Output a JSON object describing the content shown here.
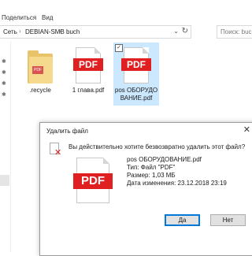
{
  "ribbon": {
    "tabs": [
      "Поделиться",
      "Вид"
    ]
  },
  "address": {
    "path": [
      "Сеть",
      "DEBIAN-SMB",
      "buch"
    ],
    "separator": "›",
    "search_placeholder": "Поиск: buch"
  },
  "files": [
    {
      "name": ".recycle",
      "icon": "folder-icon"
    },
    {
      "name": "1 глава.pdf",
      "icon": "pdf-file-icon",
      "badge": "PDF"
    },
    {
      "name": "pos ОБОРУДОВАНИЕ.pdf",
      "icon": "pdf-file-icon",
      "badge": "PDF",
      "selected": true
    }
  ],
  "dialog": {
    "title": "Удалить файл",
    "question": "Вы действительно хотите безвозвратно удалить этот файл?",
    "preview_badge": "PDF",
    "file_name": "pos ОБОРУДОВАНИЕ.pdf",
    "file_type": "Тип: Файл \"PDF\"",
    "file_size": "Размер: 1,03 МБ",
    "file_date": "Дата изменения: 23.12.2018 23:19",
    "yes_label": "Да",
    "no_label": "Нет"
  },
  "colors": {
    "pdf_red": "#e02020",
    "selection": "#cce8ff",
    "accent": "#0078d7"
  }
}
